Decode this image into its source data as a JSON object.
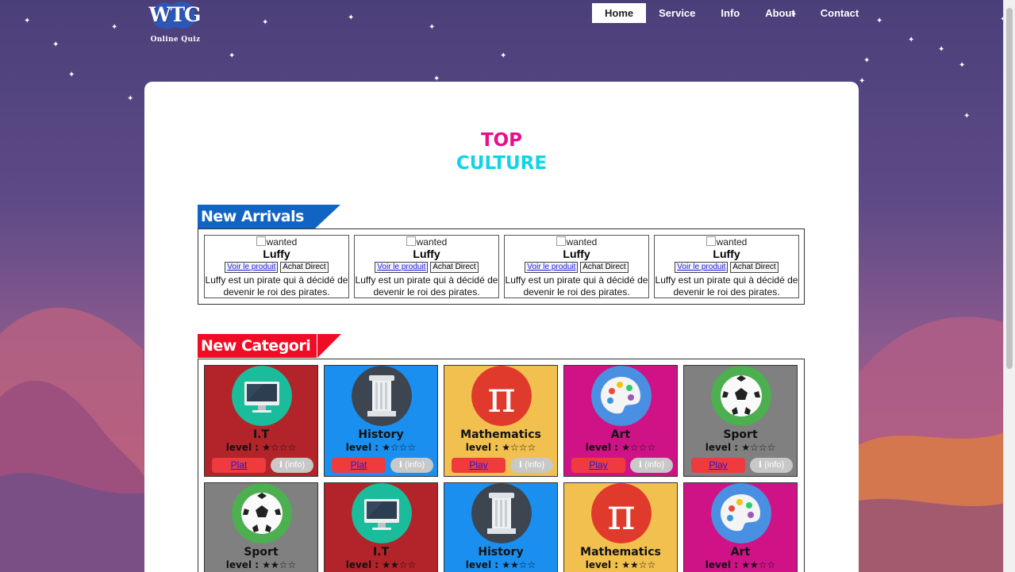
{
  "logo": {
    "word": "WTG",
    "subtitle": "Online Quiz"
  },
  "nav": [
    {
      "label": "Home",
      "active": true
    },
    {
      "label": "Service",
      "active": false
    },
    {
      "label": "Info",
      "active": false
    },
    {
      "label": "About",
      "active": false
    },
    {
      "label": "Contact",
      "active": false
    }
  ],
  "title": {
    "line1": "TOP",
    "line2": "CULTURE"
  },
  "arrivals": {
    "heading": "New Arrivals",
    "items": [
      {
        "img_alt": "wanted",
        "name": "Luffy",
        "view_label": "Voir le produit",
        "buy_label": "Achat Direct",
        "description": "Luffy est un pirate qui à décidé de devenir le roi des pirates."
      },
      {
        "img_alt": "wanted",
        "name": "Luffy",
        "view_label": "Voir le produit",
        "buy_label": "Achat Direct",
        "description": "Luffy est un pirate qui à décidé de devenir le roi des pirates."
      },
      {
        "img_alt": "wanted",
        "name": "Luffy",
        "view_label": "Voir le produit",
        "buy_label": "Achat Direct",
        "description": "Luffy est un pirate qui à décidé de devenir le roi des pirates."
      },
      {
        "img_alt": "wanted",
        "name": "Luffy",
        "view_label": "Voir le produit",
        "buy_label": "Achat Direct",
        "description": "Luffy est un pirate qui à décidé de devenir le roi des pirates."
      }
    ]
  },
  "categories": {
    "heading": "New Categori",
    "items": [
      {
        "name": "I.T",
        "level": "level : ★☆☆☆",
        "play_label": "Plat",
        "info_label": "ℹ (info)",
        "bg": "#b2232a",
        "icon": "monitor-icon"
      },
      {
        "name": "History",
        "level": "level : ★☆☆☆",
        "play_label": "Plat",
        "info_label": "ℹ (info)",
        "bg": "#1a8ff0",
        "icon": "column-icon"
      },
      {
        "name": "Mathematics",
        "level": "level : ★☆☆☆",
        "play_label": "Play",
        "info_label": "ℹ (info)",
        "bg": "#f2c04e",
        "icon": "pi-icon"
      },
      {
        "name": "Art",
        "level": "level : ★☆☆☆",
        "play_label": "Play",
        "info_label": "ℹ (info)",
        "bg": "#cf1387",
        "icon": "palette-icon"
      },
      {
        "name": "Sport",
        "level": "level : ★☆☆☆",
        "play_label": "Play",
        "info_label": "ℹ (info)",
        "bg": "#808080",
        "icon": "soccer-ball-icon"
      },
      {
        "name": "Sport",
        "level": "level : ★★☆☆",
        "play_label": "",
        "info_label": "",
        "bg": "#808080",
        "icon": "soccer-ball-icon"
      },
      {
        "name": "I.T",
        "level": "level : ★★☆☆",
        "play_label": "",
        "info_label": "",
        "bg": "#b2232a",
        "icon": "monitor-icon"
      },
      {
        "name": "History",
        "level": "level : ★★☆☆",
        "play_label": "",
        "info_label": "",
        "bg": "#1a8ff0",
        "icon": "column-icon"
      },
      {
        "name": "Mathematics",
        "level": "level : ★★☆☆",
        "play_label": "",
        "info_label": "",
        "bg": "#f2c04e",
        "icon": "pi-icon"
      },
      {
        "name": "Art",
        "level": "level : ★★☆☆",
        "play_label": "",
        "info_label": "",
        "bg": "#cf1387",
        "icon": "palette-icon"
      }
    ]
  }
}
